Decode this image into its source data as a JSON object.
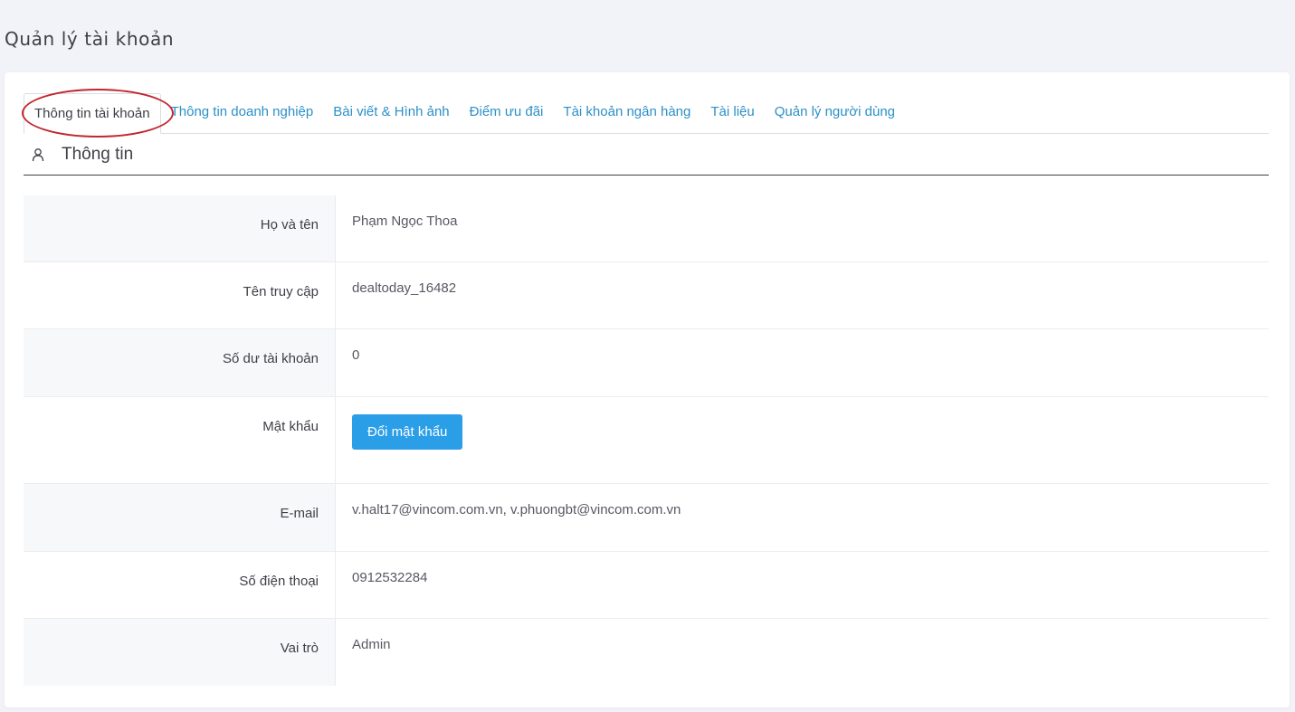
{
  "page_title": "Quản lý tài khoản",
  "tabs": [
    {
      "label": "Thông tin tài khoản",
      "active": true
    },
    {
      "label": "Thông tin doanh nghiệp",
      "active": false
    },
    {
      "label": "Bài viết & Hình ảnh",
      "active": false
    },
    {
      "label": "Điểm ưu đãi",
      "active": false
    },
    {
      "label": "Tài khoản ngân hàng",
      "active": false
    },
    {
      "label": "Tài liệu",
      "active": false
    },
    {
      "label": "Quản lý người dùng",
      "active": false
    }
  ],
  "section": {
    "title": "Thông tin",
    "icon": "user-icon"
  },
  "fields": {
    "full_name": {
      "label": "Họ và tên",
      "value": "Phạm Ngọc Thoa"
    },
    "username": {
      "label": "Tên truy cập",
      "value": "dealtoday_16482"
    },
    "balance": {
      "label": "Số dư tài khoản",
      "value": "0"
    },
    "password": {
      "label": "Mật khẩu",
      "button_label": "Đổi mật khẩu"
    },
    "email": {
      "label": "E-mail",
      "value": "v.halt17@vincom.com.vn, v.phuongbt@vincom.com.vn"
    },
    "phone": {
      "label": "Số điện thoại",
      "value": "0912532284"
    },
    "role": {
      "label": "Vai trò",
      "value": "Admin"
    }
  },
  "colors": {
    "link": "#2c8fc7",
    "button": "#2b9ee8",
    "annotation": "#c1272d"
  }
}
